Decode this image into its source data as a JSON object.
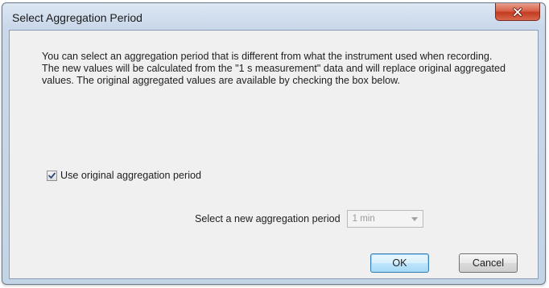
{
  "window": {
    "title": "Select Aggregation Period"
  },
  "description": "You can select an aggregation period that is different from what the instrument used when recording. The new values will be calculated from the \"1 s measurement\" data and will replace original aggregated values. The original  aggregated values are available by checking the box below.",
  "use_original": {
    "label": "Use original aggregation period",
    "checked": true
  },
  "period": {
    "label": "Select a new aggregation period",
    "value": "1 min",
    "enabled": false
  },
  "buttons": {
    "ok": "OK",
    "cancel": "Cancel"
  },
  "icons": {
    "close": "close-icon",
    "check": "check-icon",
    "dropdown": "chevron-down-icon"
  },
  "colors": {
    "close_button": "#c43b20",
    "dialog_bg": "#f0f0f0",
    "frame": "#c4d4e7",
    "ok_focus_border": "#3c7fb1"
  }
}
